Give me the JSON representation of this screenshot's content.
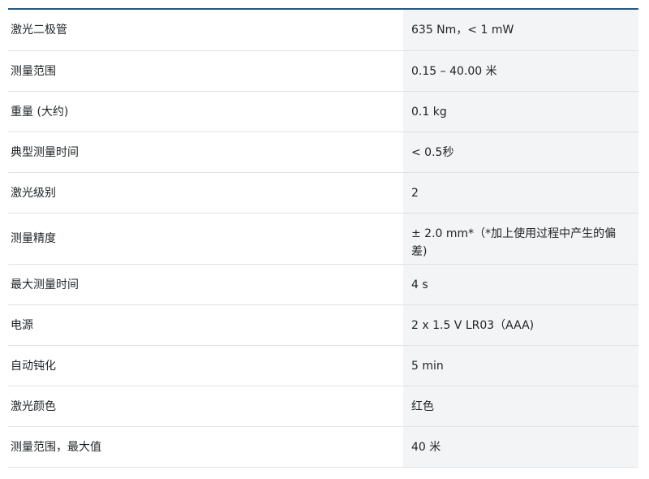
{
  "specs": [
    {
      "label": "激光二极管",
      "value": "635 Nm，< 1 mW"
    },
    {
      "label": "测量范围",
      "value": "0.15 – 40.00 米"
    },
    {
      "label": "重量 (大约)",
      "value": "0.1 kg"
    },
    {
      "label": "典型测量时间",
      "value": "< 0.5秒"
    },
    {
      "label": "激光级别",
      "value": "2"
    },
    {
      "label": "测量精度",
      "value": "± 2.0 mm*（*加上使用过程中产生的偏差)"
    },
    {
      "label": "最大测量时间",
      "value": "4 s"
    },
    {
      "label": "电源",
      "value": "2 x 1.5 V LR03（AAA)"
    },
    {
      "label": "自动钝化",
      "value": "5 min"
    },
    {
      "label": "激光颜色",
      "value": "红色"
    },
    {
      "label": "测量范围，最大值",
      "value": "40 米"
    }
  ]
}
